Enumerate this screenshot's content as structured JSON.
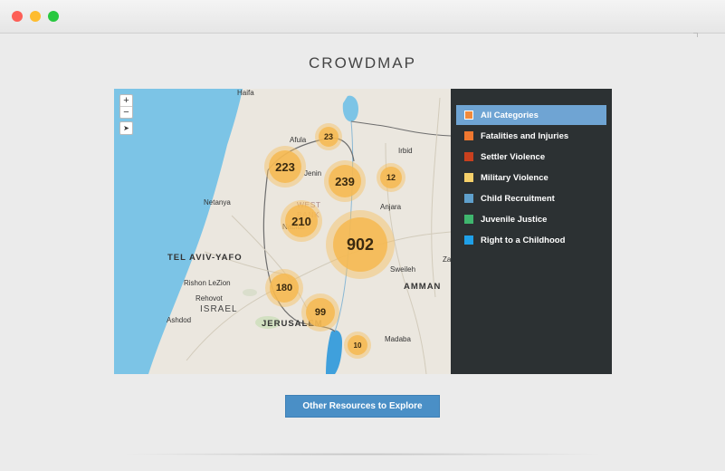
{
  "window": {
    "controls": [
      "close",
      "minimize",
      "maximize"
    ]
  },
  "page": {
    "title": "CROWDMAP"
  },
  "map": {
    "zoom_in": "+",
    "zoom_out": "−",
    "locate_icon": "locate-arrow-icon",
    "labels": {
      "haifa": "Haifa",
      "afula": "Afula",
      "jenin": "Jenin",
      "irbid": "Irbid",
      "netanya": "Netanya",
      "west": "WEST",
      "bank": "BANK",
      "nablus": "Nablus",
      "anjara": "Anjara",
      "tel_aviv": "TEL AVIV-YAFO",
      "sweileh": "Sweileh",
      "amman": "AMMAN",
      "rishon": "Rishon LeZion",
      "rehovot": "Rehovot",
      "israel": "ISRAEL",
      "ashdod": "Ashdod",
      "jerusalem": "JERUSALEM",
      "madaba": "Madaba",
      "zarqa": "Za"
    },
    "clusters": [
      {
        "label": "23",
        "count": 23
      },
      {
        "label": "223",
        "count": 223
      },
      {
        "label": "239",
        "count": 239
      },
      {
        "label": "12",
        "count": 12
      },
      {
        "label": "210",
        "count": 210
      },
      {
        "label": "902",
        "count": 902
      },
      {
        "label": "180",
        "count": 180
      },
      {
        "label": "99",
        "count": 99
      },
      {
        "label": "10",
        "count": 10
      }
    ],
    "colors": {
      "sea": "#7cc4e6",
      "land": "#ebe7df",
      "cluster": "#f6b850"
    }
  },
  "legend": {
    "items": [
      {
        "label": "All Categories",
        "color": "#f08a3c",
        "active": true
      },
      {
        "label": "Fatalities and Injuries",
        "color": "#f07830"
      },
      {
        "label": "Settler Violence",
        "color": "#c8401e"
      },
      {
        "label": "Military Violence",
        "color": "#f5d06a"
      },
      {
        "label": "Child Recruitment",
        "color": "#5fa0cc"
      },
      {
        "label": "Juvenile Justice",
        "color": "#3fb66e"
      },
      {
        "label": "Right to a Childhood",
        "color": "#1fa0e8"
      }
    ]
  },
  "button": {
    "label": "Other Resources to Explore"
  }
}
